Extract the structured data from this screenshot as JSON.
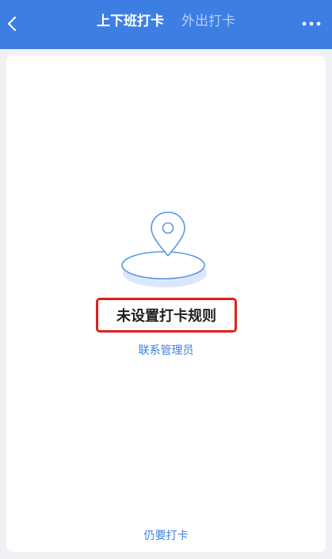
{
  "header": {
    "tabs": [
      {
        "label": "上下班打卡",
        "active": true
      },
      {
        "label": "外出打卡",
        "active": false
      }
    ]
  },
  "empty_state": {
    "title": "未设置打卡规则",
    "link_label": "联系管理员"
  },
  "footer": {
    "action_label": "仍要打卡"
  },
  "colors": {
    "brand": "#3d7ee3",
    "highlight_border": "#e0201b"
  },
  "icons": {
    "back": "chevron-left-icon",
    "more": "more-dots-icon",
    "illustration": "location-pin-icon"
  }
}
